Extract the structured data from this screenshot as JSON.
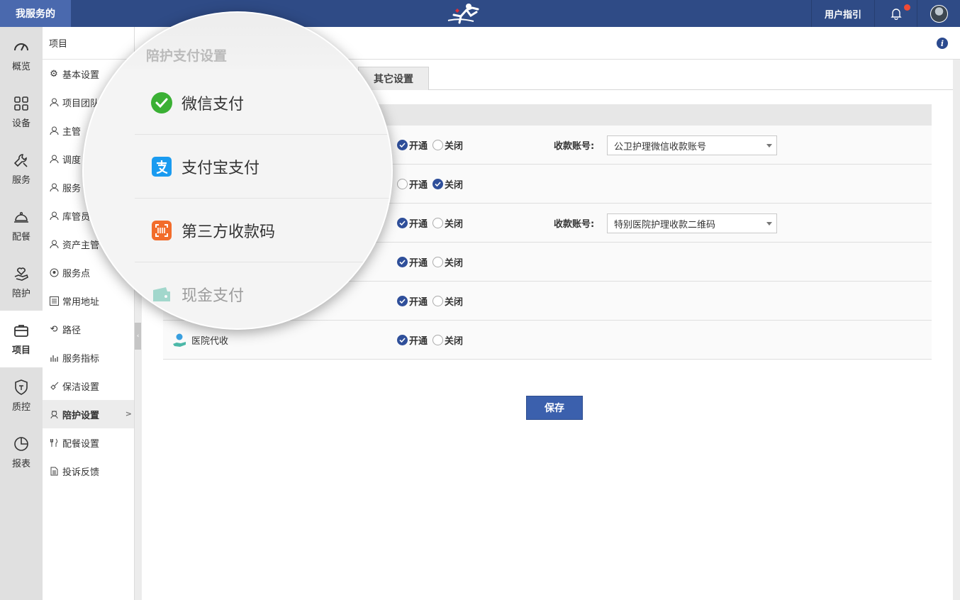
{
  "topbar": {
    "brand": "我服务的",
    "guide": "用户指引",
    "bell_icon": "bell-icon",
    "accent": "#2f4b86"
  },
  "rail": {
    "items": [
      {
        "label": "概览",
        "icon": "gauge-icon"
      },
      {
        "label": "设备",
        "icon": "grid-icon"
      },
      {
        "label": "服务",
        "icon": "wrench-icon"
      },
      {
        "label": "配餐",
        "icon": "cloche-icon"
      },
      {
        "label": "陪护",
        "icon": "hand-heart-icon"
      },
      {
        "label": "项目",
        "icon": "briefcase-icon",
        "active": true
      },
      {
        "label": "质控",
        "icon": "shield-icon"
      },
      {
        "label": "报表",
        "icon": "pie-chart-icon"
      }
    ]
  },
  "sub": {
    "title": "项目",
    "items": [
      {
        "label": "基本设置"
      },
      {
        "label": "项目团队"
      },
      {
        "label": "主管"
      },
      {
        "label": "调度"
      },
      {
        "label": "服务"
      },
      {
        "label": "库管员"
      },
      {
        "label": "资产主管"
      },
      {
        "label": "服务点"
      },
      {
        "label": "常用地址"
      },
      {
        "label": "路径"
      },
      {
        "label": "服务指标"
      },
      {
        "label": "保洁设置"
      },
      {
        "label": "陪护设置",
        "active": true
      },
      {
        "label": "配餐设置"
      },
      {
        "label": "投诉反馈"
      }
    ]
  },
  "tabs": {
    "other": "其它设置"
  },
  "rows": [
    {
      "name": "",
      "on_label": "开通",
      "off_label": "关闭",
      "checked": "on",
      "account_label": "收款账号:",
      "account": "公卫护理微信收款账号"
    },
    {
      "name": "",
      "on_label": "开通",
      "off_label": "关闭",
      "checked": "off"
    },
    {
      "name": "",
      "on_label": "开通",
      "off_label": "关闭",
      "checked": "on",
      "account_label": "收款账号:",
      "account": "特别医院护理收款二维码"
    },
    {
      "name": "",
      "on_label": "开通",
      "off_label": "关闭",
      "checked": "on"
    },
    {
      "name": "",
      "on_label": "开通",
      "off_label": "关闭",
      "checked": "on"
    },
    {
      "name": "医院代收",
      "on_label": "开通",
      "off_label": "关闭",
      "checked": "on"
    }
  ],
  "save_label": "保存",
  "lens": {
    "title": "陪护支付设置",
    "items": [
      {
        "label": "微信支付",
        "icon": "wechat-icon"
      },
      {
        "label": "支付宝支付",
        "icon": "alipay-icon"
      },
      {
        "label": "第三方收款码",
        "icon": "qrcode-icon"
      },
      {
        "label": "现金支付",
        "icon": "cash-icon"
      }
    ]
  }
}
